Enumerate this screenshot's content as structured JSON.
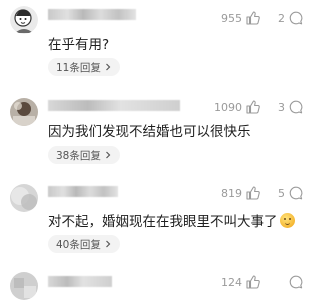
{
  "colors": {
    "text": "#1f1f1f",
    "muted": "#9a9a9a",
    "pill_bg": "#f3f3f3"
  },
  "comments": [
    {
      "likes": "955",
      "replies_count": "2",
      "text": "在乎有用?",
      "replies_label": "11条回复",
      "avatar": "cartoon-avatar"
    },
    {
      "likes": "1090",
      "replies_count": "3",
      "text": "因为我们发现不结婚也可以很快乐",
      "replies_label": "38条回复",
      "avatar": "photo-avatar"
    },
    {
      "likes": "819",
      "replies_count": "5",
      "text": "对不起，婚姻现在在我眼里不叫大事了",
      "emoji": "embarrassed-smile-emoji",
      "replies_label": "40条回复",
      "avatar": "blurred-avatar"
    },
    {
      "likes": "124",
      "replies_count": "",
      "avatar": "blurred-avatar"
    }
  ],
  "icons": {
    "like": "thumbs-up-icon",
    "reply": "reply-bubble-icon",
    "chevron": "chevron-right-icon"
  }
}
